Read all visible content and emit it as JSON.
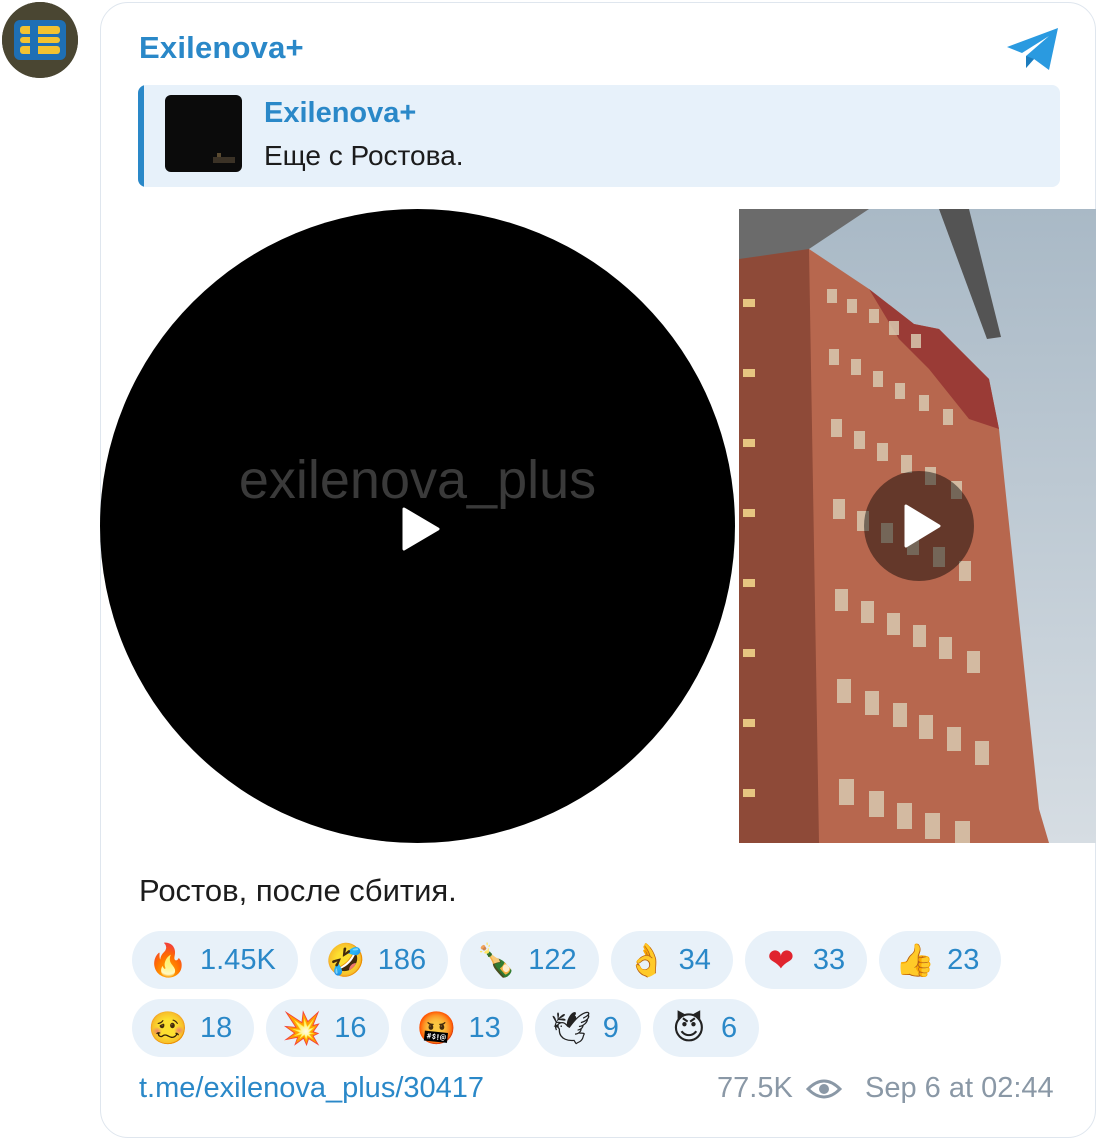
{
  "channel": {
    "name": "Exilenova+"
  },
  "reply": {
    "title": "Exilenova+",
    "text": "Еще с Ростова."
  },
  "media": {
    "round_video": {
      "watermark": "exilenova_plus"
    },
    "side_video": {}
  },
  "caption": "Ростов, после сбития.",
  "reactions": [
    [
      {
        "icon": "fire-emoji",
        "glyph": "🔥",
        "count": "1.45K"
      },
      {
        "icon": "rolling-laughing-emoji",
        "glyph": "🤣",
        "count": "186"
      },
      {
        "icon": "champagne-emoji",
        "glyph": "🍾",
        "count": "122"
      },
      {
        "icon": "ok-hand-emoji",
        "glyph": "👌",
        "count": "34"
      },
      {
        "icon": "red-heart-emoji",
        "glyph": "❤",
        "count": "33"
      },
      {
        "icon": "thumbs-up-emoji",
        "glyph": "👍",
        "count": "23"
      }
    ],
    [
      {
        "icon": "woozy-face-emoji",
        "glyph": "🥴",
        "count": "18"
      },
      {
        "icon": "explosion-custom-emoji",
        "glyph": "💥",
        "count": "16"
      },
      {
        "icon": "cursing-face-emoji",
        "glyph": "🤬",
        "count": "13"
      },
      {
        "icon": "dove-emoji",
        "glyph": "🕊",
        "count": "9"
      },
      {
        "icon": "smiling-devil-emoji",
        "glyph": "😈",
        "count": "6"
      }
    ]
  ],
  "footer": {
    "link": "t.me/exilenova_plus/30417",
    "views": "77.5K",
    "date": "Sep 6 at 02:44"
  },
  "colors": {
    "accent": "#2a88c8",
    "reaction_bg": "#e8f1f9",
    "muted": "#8a98a6"
  }
}
